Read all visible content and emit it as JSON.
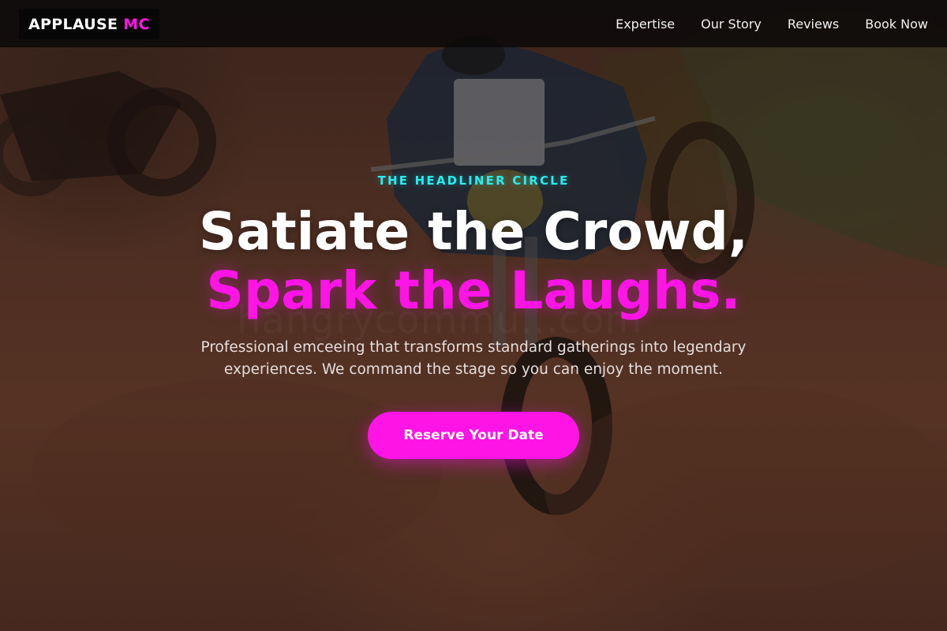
{
  "brand": {
    "name_primary": "APPLAUSE",
    "name_accent": "MC",
    "accent_color": "#ff14e6",
    "secondary_color": "#28ecf0"
  },
  "nav": {
    "items": [
      {
        "label": "Expertise"
      },
      {
        "label": "Our Story"
      },
      {
        "label": "Reviews"
      },
      {
        "label": "Book Now"
      }
    ]
  },
  "hero": {
    "eyebrow": "THE HEADLINER CIRCLE",
    "headline_line1": "Satiate the Crowd,",
    "headline_line2": "Spark the Laughs.",
    "subtitle": "Professional emceeing that transforms standard gatherings into legendary experiences. We command the stage so you can enjoy the moment.",
    "cta_label": "Reserve Your Date",
    "background_image": "motocross-race-photo",
    "watermark_text": "hangrycommu...com"
  }
}
